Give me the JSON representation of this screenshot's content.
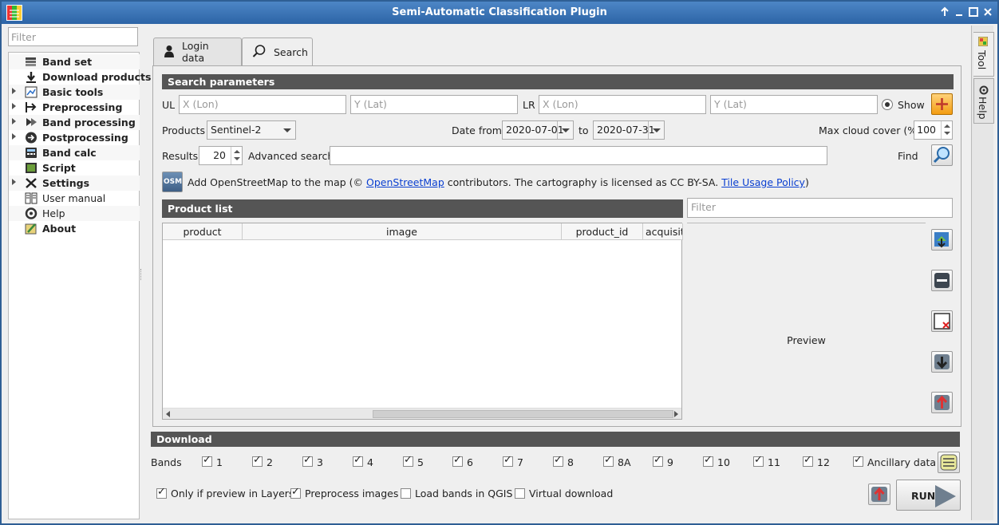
{
  "window": {
    "title": "Semi-Automatic Classification Plugin"
  },
  "titlebar_buttons": [
    "up-icon",
    "minimize-icon",
    "maximize-icon",
    "close-icon"
  ],
  "left": {
    "filter_placeholder": "Filter",
    "items": [
      {
        "label": "Band set",
        "bold": true,
        "expandable": false,
        "icon": "band-set-icon"
      },
      {
        "label": "Download products",
        "bold": true,
        "expandable": false,
        "icon": "download-icon"
      },
      {
        "label": "Basic tools",
        "bold": true,
        "expandable": true,
        "icon": "basic-tools-icon"
      },
      {
        "label": "Preprocessing",
        "bold": true,
        "expandable": true,
        "icon": "preprocessing-icon"
      },
      {
        "label": "Band processing",
        "bold": true,
        "expandable": true,
        "icon": "band-processing-icon"
      },
      {
        "label": "Postprocessing",
        "bold": true,
        "expandable": true,
        "icon": "postprocessing-icon"
      },
      {
        "label": "Band calc",
        "bold": true,
        "expandable": false,
        "icon": "band-calc-icon"
      },
      {
        "label": "Script",
        "bold": true,
        "expandable": false,
        "icon": "script-icon"
      },
      {
        "label": "Settings",
        "bold": true,
        "expandable": true,
        "icon": "settings-icon"
      },
      {
        "label": "User manual",
        "bold": false,
        "expandable": false,
        "icon": "manual-icon"
      },
      {
        "label": "Help",
        "bold": false,
        "expandable": false,
        "icon": "help-icon"
      },
      {
        "label": "About",
        "bold": true,
        "expandable": false,
        "icon": "about-icon"
      }
    ]
  },
  "tabs": [
    {
      "label": "Login data",
      "icon": "user-icon",
      "active": false
    },
    {
      "label": "Search",
      "icon": "search-icon",
      "active": true
    }
  ],
  "search": {
    "section_title": "Search parameters",
    "ul_label": "UL",
    "lr_label": "LR",
    "x_placeholder": "X (Lon)",
    "y_placeholder": "Y (Lat)",
    "show_label": "Show",
    "products_label": "Products",
    "product_value": "Sentinel-2",
    "date_from_label": "Date from",
    "date_from": "2020-07-01",
    "to_label": "to",
    "date_to": "2020-07-31",
    "max_cloud_label": "Max cloud cover (%)",
    "max_cloud_value": "100",
    "results_label": "Results",
    "results_value": "20",
    "advanced_label": "Advanced search",
    "advanced_value": "",
    "find_label": "Find",
    "osm_icon_text": "OSM",
    "osm_text_1": "Add OpenStreetMap to the map  (©",
    "osm_link_1": "OpenStreetMap",
    "osm_text_2": "contributors. The cartography is licensed as CC BY-SA.",
    "osm_link_2": "Tile Usage Policy",
    "osm_text_3": ")"
  },
  "product_list": {
    "section_title": "Product list",
    "filter_placeholder": "Filter",
    "columns": [
      "product",
      "image",
      "product_id",
      "acquisiti"
    ],
    "preview_text": "Preview"
  },
  "download": {
    "section_title": "Download",
    "bands_label": "Bands",
    "bands": [
      "1",
      "2",
      "3",
      "4",
      "5",
      "6",
      "7",
      "8",
      "8A",
      "9",
      "10",
      "11",
      "12"
    ],
    "ancillary_label": "Ancillary data",
    "options": [
      {
        "label": "Only if preview in Layers",
        "checked": true
      },
      {
        "label": "Preprocess images",
        "checked": true
      },
      {
        "label": "Load bands in QGIS",
        "checked": false
      },
      {
        "label": "Virtual download",
        "checked": false
      }
    ],
    "run_label": "RUN"
  },
  "side_tabs": [
    {
      "label": "Tool",
      "icon": "tool-icon"
    },
    {
      "label": "Help",
      "icon": "help-icon"
    }
  ],
  "colors": {
    "titlebar": "#2c64a6",
    "section_bar": "#555555",
    "link": "#0a3fd1",
    "accent_orange": "#f5a623"
  }
}
